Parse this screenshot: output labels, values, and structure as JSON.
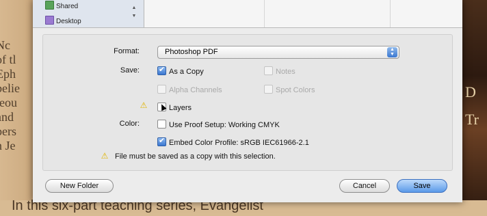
{
  "background": {
    "left_fragments": [
      "Nc",
      "of tl",
      "Eph",
      "belie",
      "teou",
      "and",
      "pers",
      "n Je"
    ],
    "right_fragments": [
      "D",
      "Tr"
    ],
    "bottom_text": "In this six-part teaching series, Evangelist"
  },
  "sidebar": {
    "items": [
      {
        "label": "Shared",
        "icon": "shared-folder-icon"
      },
      {
        "label": "Desktop",
        "icon": "desktop-folder-icon"
      }
    ],
    "stepper_up": "▲",
    "stepper_down": "▼"
  },
  "format": {
    "label": "Format:",
    "value": "Photoshop PDF"
  },
  "save": {
    "label": "Save:",
    "as_a_copy": "As a Copy",
    "notes": "Notes",
    "alpha_channels": "Alpha Channels",
    "spot_colors": "Spot Colors",
    "layers": "Layers"
  },
  "color": {
    "label": "Color:",
    "use_proof_setup": "Use Proof Setup:  Working CMYK",
    "embed_color_profile": "Embed Color Profile:  sRGB IEC61966-2.1"
  },
  "warning_message": "File must be saved as a copy with this selection.",
  "buttons": {
    "new_folder": "New Folder",
    "cancel": "Cancel",
    "save": "Save"
  },
  "colors": {
    "accent": "#3a76d0",
    "warning": "#e0b400"
  }
}
